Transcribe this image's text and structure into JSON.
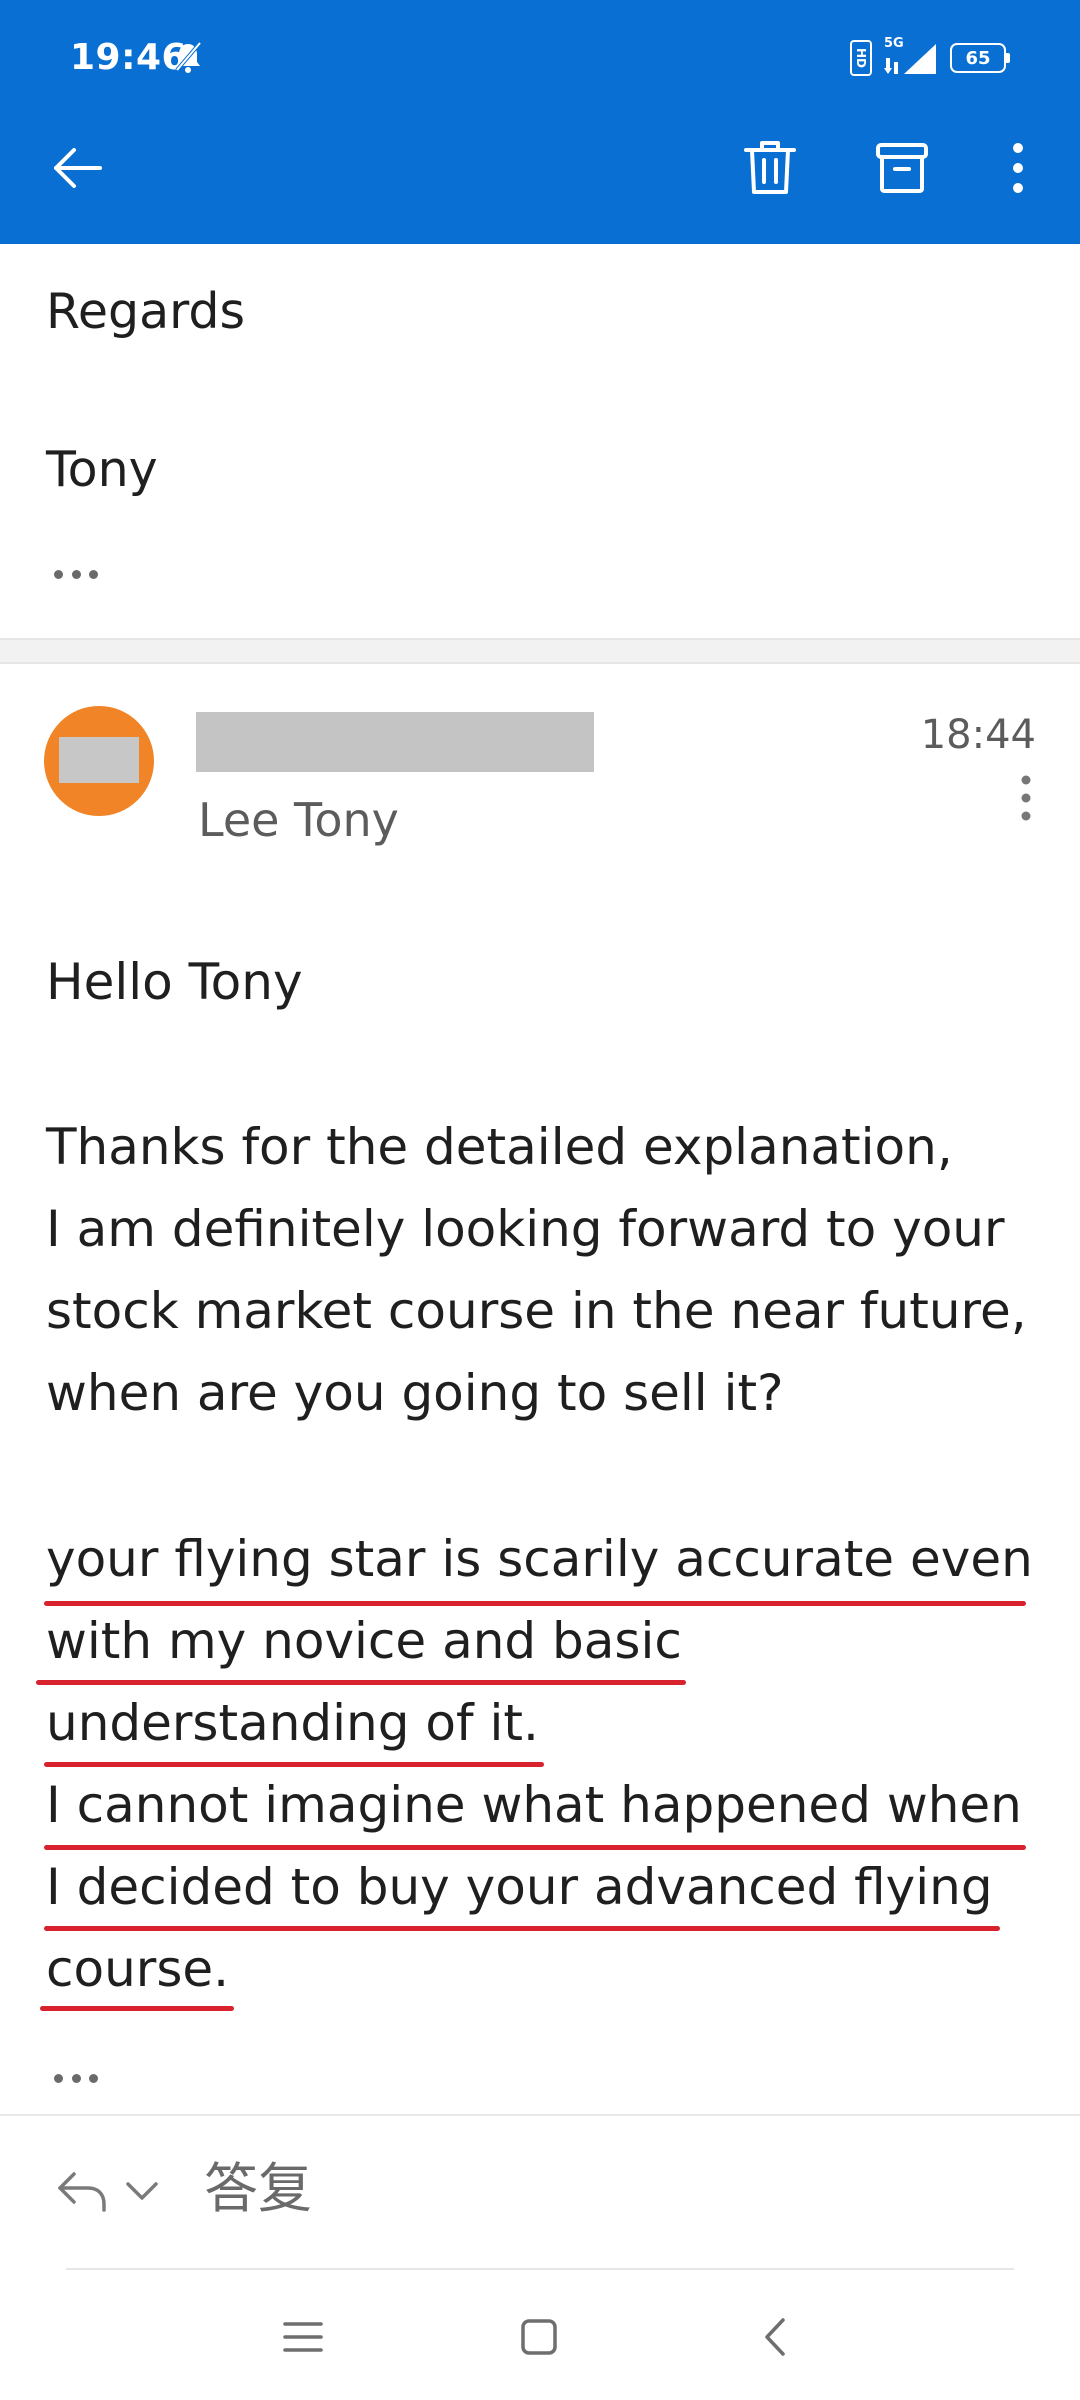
{
  "status_bar": {
    "time": "19:46",
    "battery": "65",
    "network": "5G"
  },
  "toolbar": {
    "icons": [
      "back-arrow-icon",
      "trash-icon",
      "archive-icon",
      "more-vertical-icon"
    ]
  },
  "previous_message": {
    "lines": [
      "Regards",
      "Tony"
    ]
  },
  "message": {
    "sender_name": "Lee Tony",
    "time": "18:44",
    "avatar_color": "#f08426",
    "greeting": "Hello Tony",
    "paragraph1": [
      "Thanks for the detailed explanation,",
      "I am definitely looking forward to your",
      "stock market course in the near future,",
      "when are you going to sell it?"
    ],
    "paragraph2": [
      "your flying star is scarily accurate even",
      "with my novice and basic",
      "understanding of it.",
      "I cannot imagine what happened when",
      "I decided to buy your advanced flying",
      "course."
    ]
  },
  "reply_bar": {
    "label": "答复"
  },
  "colors": {
    "appbar": "#0a6fd3",
    "underline": "#d8232f"
  }
}
